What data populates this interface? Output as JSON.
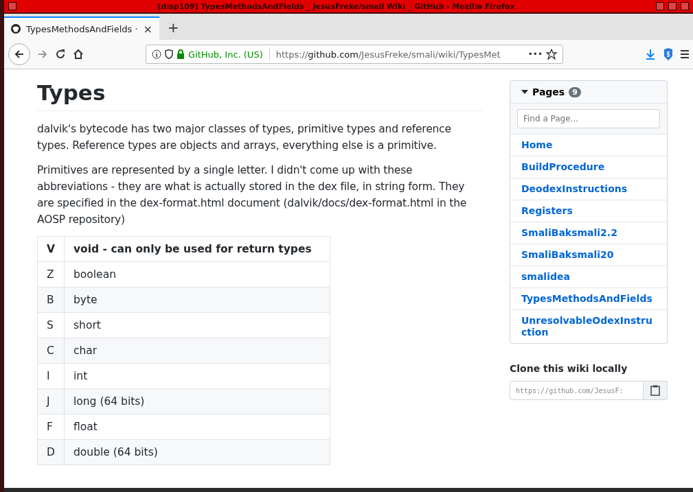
{
  "window": {
    "title": "[disp109] TypesMethodsAndFields _ JesusFreke/smali Wiki _ GitHub - Mozilla Firefox"
  },
  "tabs": [
    {
      "label": "TypesMethodsAndFields ·",
      "selected": true,
      "close": "×"
    }
  ],
  "new_tab": "+",
  "address_bar": {
    "identity": "GitHub, Inc. (US)",
    "url_prefix": "https://",
    "url_domain": "github.com",
    "url_path": "/JesusFreke/smali/wiki/TypesMet",
    "more": "•••"
  },
  "article": {
    "title": "Types",
    "paragraphs": [
      "dalvik's bytecode has two major classes of types, primitive types and reference types. Reference types are objects and arrays, everything else is a primitive.",
      "Primitives are represented by a single letter. I didn't come up with these abbreviations - they are what is actually stored in the dex file, in string form. They are specified in the dex-format.html document (dalvik/docs/dex-format.html in the AOSP repository)"
    ],
    "table": {
      "header": [
        "V",
        "void - can only be used for return types"
      ],
      "rows": [
        [
          "Z",
          "boolean"
        ],
        [
          "B",
          "byte"
        ],
        [
          "S",
          "short"
        ],
        [
          "C",
          "char"
        ],
        [
          "I",
          "int"
        ],
        [
          "J",
          "long (64 bits)"
        ],
        [
          "F",
          "float"
        ],
        [
          "D",
          "double (64 bits)"
        ]
      ]
    }
  },
  "sidebar": {
    "pages_title": "Pages",
    "pages_count": "9",
    "expanded": true,
    "search": {
      "placeholder": "Find a Page..."
    },
    "pages": [
      "Home",
      "BuildProcedure",
      "DeodexInstructions",
      "Registers",
      "SmaliBaksmali2.2",
      "SmaliBaksmali20",
      "smalidea",
      "TypesMethodsAndFields",
      "UnresolvableOdexInstruction"
    ],
    "clone_title": "Clone this wiki locally",
    "clone_url": "https://github.com/JesusF:"
  }
}
